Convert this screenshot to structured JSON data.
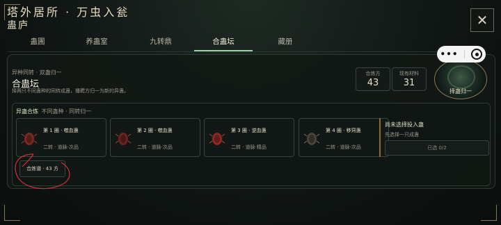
{
  "header": {
    "title": "塔外居所 · 万虫入瓮",
    "subtitle": "蛊庐",
    "close_icon": "✕"
  },
  "tabs": [
    {
      "label": "蛊圃",
      "active": false
    },
    {
      "label": "养蛊室",
      "active": false
    },
    {
      "label": "九转鼎",
      "active": false
    },
    {
      "label": "合蛊坛",
      "active": true
    },
    {
      "label": "藏册",
      "active": false
    }
  ],
  "mode": {
    "label": "异种同转 · 双蛊归一",
    "title": "合蛊坛",
    "desc": "择两只不同蛊种的同转成蛊，播聘方归一为新的异蛊。"
  },
  "stats": [
    {
      "label": "合炼方",
      "value": "43"
    },
    {
      "label": "现有材料",
      "value": "31"
    }
  ],
  "medallion": {
    "label": "择蛊归一"
  },
  "combine": {
    "heading": "异蛊合炼",
    "desc": "不同蛊种 · 同转归一",
    "slots": [
      {
        "name": "第 1 圈 · 噬血蛊",
        "tier": "二转 · 道脉·次品",
        "color": "#7a2a20"
      },
      {
        "name": "第 2 圈 · 噬血蛊",
        "tier": "二转 · 道脉·次品",
        "color": "#6a2420"
      },
      {
        "name": "第 3 圈 · 逆血蛊",
        "tier": "二转 · 道脉·精品",
        "color": "#8a2a24"
      },
      {
        "name": "第 4 圈 · 移窍蛊",
        "tier": "二转 · 道脉·次品",
        "color": "#4a4440"
      }
    ],
    "select_title": "尚未选择投入蛊",
    "select_hint": "先选择一只成蛊",
    "selected_count": "已选 0/2",
    "recipe_pill": "合炼谱 · 43 方"
  },
  "capsule": {
    "more_icon": "•••",
    "target_icon": "◉"
  },
  "colors": {
    "accent": "#9fd0a8",
    "gold": "#8a7a55",
    "annotation": "#d0303a"
  }
}
